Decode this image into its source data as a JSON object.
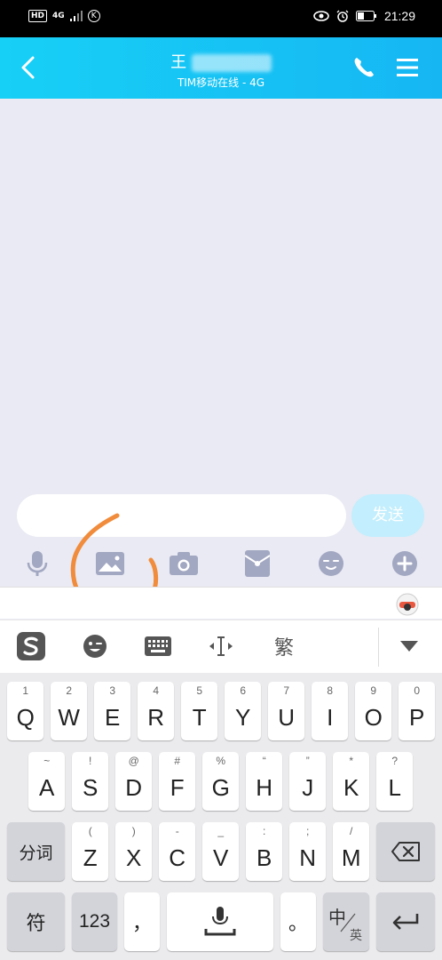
{
  "statusbar": {
    "hd": "HD",
    "net": "4G",
    "k_icon": "K",
    "time": "21:29"
  },
  "titlebar": {
    "name": "王",
    "status": "TIM移动在线 - 4G"
  },
  "chat": {
    "send_label": "发送"
  },
  "ime": {
    "traditional_label": "繁"
  },
  "keyboard": {
    "row1": [
      {
        "main": "Q",
        "sub": "1"
      },
      {
        "main": "W",
        "sub": "2"
      },
      {
        "main": "E",
        "sub": "3"
      },
      {
        "main": "R",
        "sub": "4"
      },
      {
        "main": "T",
        "sub": "5"
      },
      {
        "main": "Y",
        "sub": "6"
      },
      {
        "main": "U",
        "sub": "7"
      },
      {
        "main": "I",
        "sub": "8"
      },
      {
        "main": "O",
        "sub": "9"
      },
      {
        "main": "P",
        "sub": "0"
      }
    ],
    "row2": [
      {
        "main": "A",
        "sub": "~"
      },
      {
        "main": "S",
        "sub": "!"
      },
      {
        "main": "D",
        "sub": "@"
      },
      {
        "main": "F",
        "sub": "#"
      },
      {
        "main": "G",
        "sub": "%"
      },
      {
        "main": "H",
        "sub": "“"
      },
      {
        "main": "J",
        "sub": "”"
      },
      {
        "main": "K",
        "sub": "*"
      },
      {
        "main": "L",
        "sub": "?"
      }
    ],
    "row3": [
      {
        "main": "Z",
        "sub": "("
      },
      {
        "main": "X",
        "sub": ")"
      },
      {
        "main": "C",
        "sub": "-"
      },
      {
        "main": "V",
        "sub": "_"
      },
      {
        "main": "B",
        "sub": ":"
      },
      {
        "main": "N",
        "sub": ";"
      },
      {
        "main": "M",
        "sub": "/"
      }
    ],
    "segment_label": "分词",
    "symbol_label": "符",
    "numbers_label": "123",
    "comma_label": "，",
    "period_label": "。",
    "lang_zh": "中",
    "lang_en": "英"
  }
}
